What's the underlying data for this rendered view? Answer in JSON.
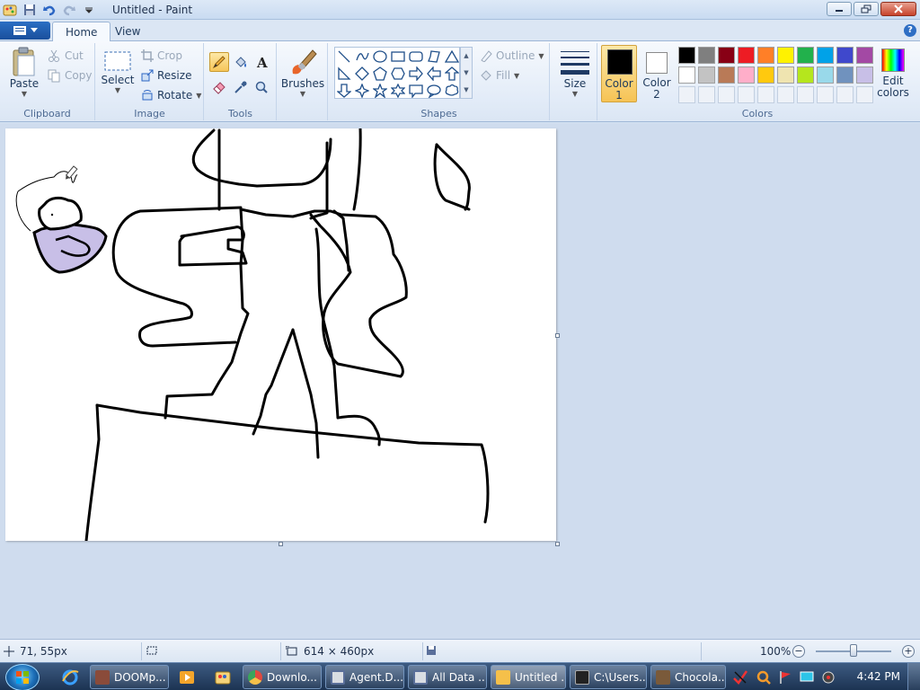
{
  "window": {
    "title": "Untitled - Paint"
  },
  "tabs": [
    {
      "label": "Home",
      "active": true
    },
    {
      "label": "View",
      "active": false
    }
  ],
  "ribbon": {
    "clipboard": {
      "group_label": "Clipboard",
      "paste": "Paste",
      "cut": "Cut",
      "copy": "Copy"
    },
    "image": {
      "group_label": "Image",
      "select": "Select",
      "crop": "Crop",
      "resize": "Resize",
      "rotate": "Rotate"
    },
    "tools": {
      "group_label": "Tools",
      "selected_tool": "pencil"
    },
    "brushes": {
      "label": "Brushes"
    },
    "shapes": {
      "group_label": "Shapes",
      "outline": "Outline",
      "fill": "Fill"
    },
    "size": {
      "label": "Size"
    },
    "colors": {
      "group_label": "Colors",
      "color1_label_line1": "Color",
      "color1_label_line2": "1",
      "color2_label_line1": "Color",
      "color2_label_line2": "2",
      "color1": "#000000",
      "color2": "#ffffff",
      "edit_line1": "Edit",
      "edit_line2": "colors",
      "palette_row1": [
        "#000000",
        "#7f7f7f",
        "#880015",
        "#ed1c24",
        "#ff7f27",
        "#fff200",
        "#22b14c",
        "#00a2e8",
        "#3f48cc",
        "#a349a4"
      ],
      "palette_row2": [
        "#ffffff",
        "#c3c3c3",
        "#b97a57",
        "#ffaec9",
        "#ffc90e",
        "#efe4b0",
        "#b5e61d",
        "#99d9ea",
        "#7092be",
        "#c8bfe7"
      ]
    }
  },
  "status": {
    "cursor_pos": "71, 55px",
    "canvas_size": "614 × 460px",
    "zoom": "100%",
    "zoom_level": 100
  },
  "taskbar": {
    "buttons": [
      {
        "label": "DOOMp...",
        "icon_color": "#8a4b3a",
        "active": false
      },
      {
        "label": "Downlo...",
        "icon_color": "#e04a3f",
        "active": false
      },
      {
        "label": "Agent.D...",
        "icon_color": "#d9dde3",
        "active": false
      },
      {
        "label": "All Data ...",
        "icon_color": "#d9dde3",
        "active": false
      },
      {
        "label": "Untitled ...",
        "icon_color": "#f5c04a",
        "active": true
      },
      {
        "label": "C:\\Users...",
        "icon_color": "#222222",
        "active": false
      },
      {
        "label": "Chocola...",
        "icon_color": "#7a5a3a",
        "active": false
      }
    ],
    "clock": "4:42 PM"
  }
}
